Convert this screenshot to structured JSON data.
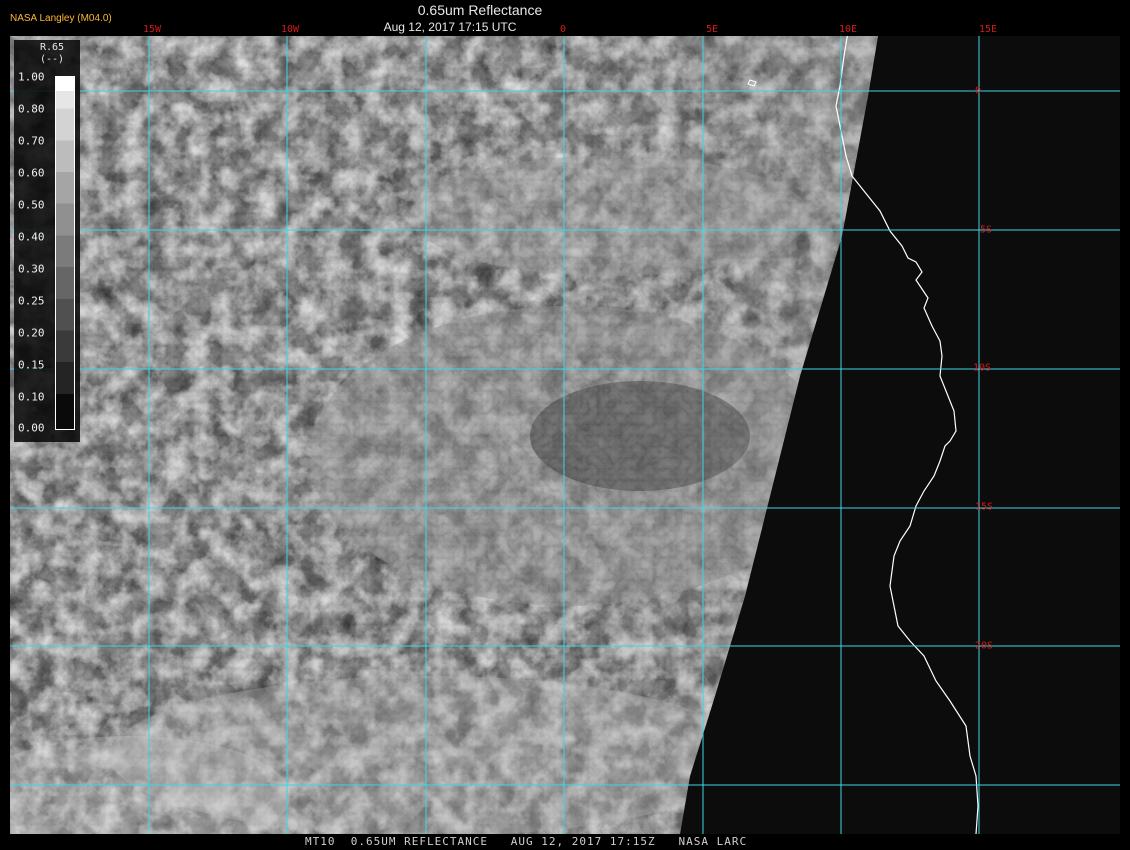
{
  "header": {
    "org": "NASA Langley (M04.0)",
    "title": "0.65um Reflectance",
    "subtitle": "Aug 12, 2017 17:15 UTC"
  },
  "footer": {
    "caption": "MT10  0.65UM REFLECTANCE   AUG 12, 2017 17:15Z   NASA LARC"
  },
  "colorbar": {
    "label": "R.65",
    "units": "(--)",
    "ticks": [
      "1.00",
      "0.80",
      "0.70",
      "0.60",
      "0.50",
      "0.40",
      "0.30",
      "0.25",
      "0.20",
      "0.15",
      "0.10",
      "0.00"
    ]
  },
  "grid": {
    "lon_labels": [
      "15W",
      "10W",
      "0",
      "5E",
      "10E",
      "15E"
    ],
    "lat_labels": [
      "0",
      "5S",
      "10S",
      "15S",
      "20S"
    ],
    "line_color": "#3fd6e6",
    "label_color": "#d31b1b"
  },
  "colors": {
    "background": "#000000",
    "org_text": "#ffb733",
    "coastline": "#ffffff"
  }
}
